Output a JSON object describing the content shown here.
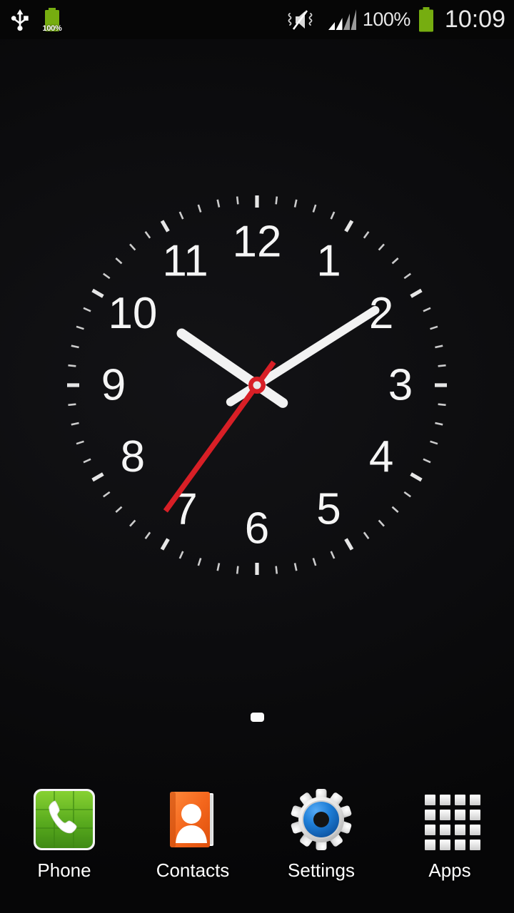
{
  "status_bar": {
    "left_icons": [
      {
        "name": "usb-icon",
        "label": "USB connected"
      },
      {
        "name": "battery-charging-icon",
        "label": "100%"
      }
    ],
    "usb_label": "USB connected",
    "battery_left_percent": "100%",
    "mute_icon_label": "Vibrate / sound off",
    "signal_icon_label": "Signal strength",
    "signal_bars_filled": 2,
    "signal_bars_total": 4,
    "battery_percent": "100%",
    "battery_icon_label": "Battery full",
    "clock": "10:09",
    "background": "#060606",
    "text_color": "#e9e9e9",
    "battery_color": "#76ad10"
  },
  "clock_widget": {
    "name": "analog-clock-widget",
    "time": "10:09",
    "hour": 10,
    "minute": 9,
    "second": 36,
    "hour_angle": 304.5,
    "minute_angle": 57.6,
    "second_angle": 216,
    "numerals": [
      "12",
      "1",
      "2",
      "3",
      "4",
      "5",
      "6",
      "7",
      "8",
      "9",
      "10",
      "11"
    ],
    "hand_color": "#f2f2f2",
    "second_hand_color": "#d81f26",
    "hub_color": "#d81f26",
    "tick_color": "#ededed",
    "face_color": "#0a0a0c"
  },
  "page_indicator": {
    "name": "home-page-indicator",
    "total_pages": 1,
    "current_page": 1,
    "dot_color": "#fafafa"
  },
  "dock": {
    "items": [
      {
        "name": "phone",
        "label": "Phone",
        "icon": "phone-icon",
        "color": "#5aa821"
      },
      {
        "name": "contacts",
        "label": "Contacts",
        "icon": "contacts-book-icon",
        "color": "#f2661e"
      },
      {
        "name": "settings",
        "label": "Settings",
        "icon": "gear-icon",
        "color": "#1877d4"
      },
      {
        "name": "apps",
        "label": "Apps",
        "icon": "apps-grid-icon",
        "color": "#e4e4e4"
      }
    ],
    "label_color": "#ffffff"
  },
  "wallpaper": {
    "type": "solid-dark",
    "color": "#0c0c0e"
  }
}
